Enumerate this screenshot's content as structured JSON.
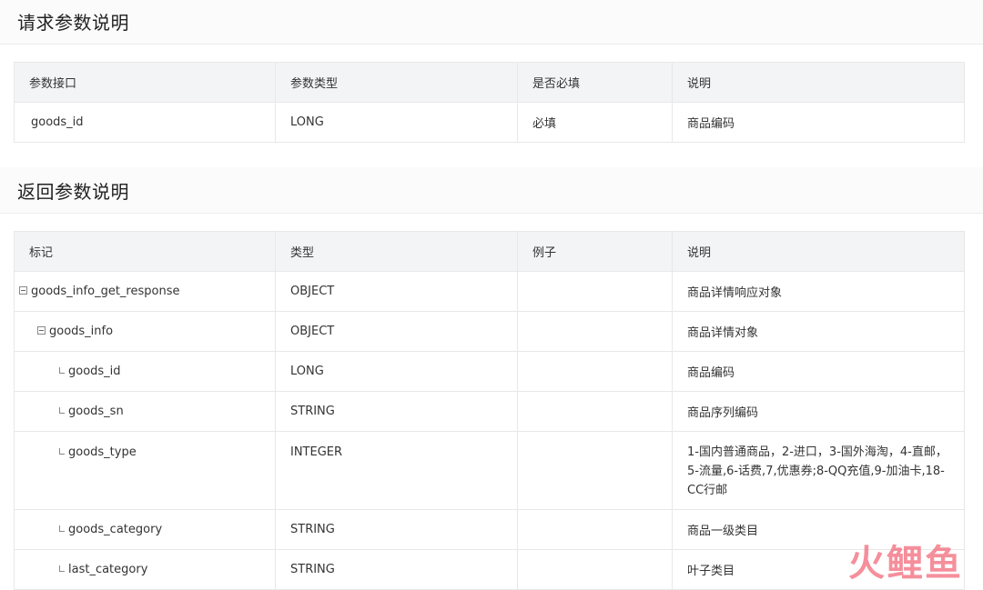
{
  "request_section": {
    "title": "请求参数说明",
    "columns": [
      "参数接口",
      "参数类型",
      "是否必填",
      "说明"
    ],
    "rows": [
      {
        "name": "goods_id",
        "type": "LONG",
        "required": "必填",
        "desc": "商品编码"
      }
    ]
  },
  "response_section": {
    "title": "返回参数说明",
    "columns": [
      "标记",
      "类型",
      "例子",
      "说明"
    ],
    "rows": [
      {
        "name": "goods_info_get_response",
        "type": "OBJECT",
        "example": "",
        "desc": "商品详情响应对象"
      },
      {
        "name": "goods_info",
        "type": "OBJECT",
        "example": "",
        "desc": "商品详情对象"
      },
      {
        "name": "goods_id",
        "type": "LONG",
        "example": "",
        "desc": "商品编码"
      },
      {
        "name": "goods_sn",
        "type": "STRING",
        "example": "",
        "desc": "商品序列编码"
      },
      {
        "name": "goods_type",
        "type": "INTEGER",
        "example": "",
        "desc": "1-国内普通商品，2-进口，3-国外海淘，4-直邮，5-流量,6-话费,7,优惠券;8-QQ充值,9-加油卡,18-CC行邮"
      },
      {
        "name": "goods_category",
        "type": "STRING",
        "example": "",
        "desc": "商品一级类目"
      },
      {
        "name": "last_category",
        "type": "STRING",
        "example": "",
        "desc": "叶子类目"
      }
    ]
  },
  "watermark": "火鲤鱼"
}
